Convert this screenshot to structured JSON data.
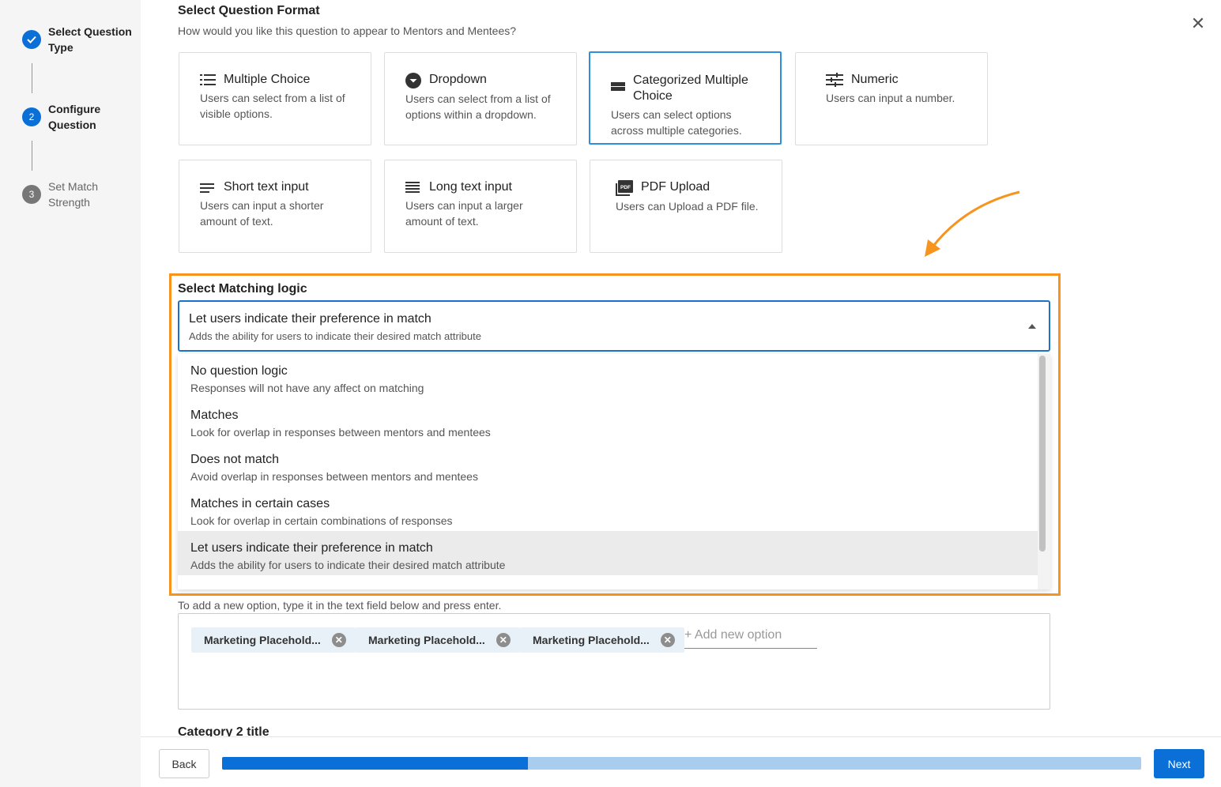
{
  "stepper": {
    "steps": [
      {
        "number": "1",
        "label": "Select Question Type",
        "status": "done"
      },
      {
        "number": "2",
        "label": "Configure Question",
        "status": "active"
      },
      {
        "number": "3",
        "label": "Set Match Strength",
        "status": "pending"
      }
    ]
  },
  "header": {
    "title": "Select Question Format",
    "subtitle": "How would you like this question to appear to Mentors and Mentees?"
  },
  "formats": [
    {
      "title": "Multiple Choice",
      "desc": "Users can select from a list of visible options.",
      "icon": "list-icon"
    },
    {
      "title": "Dropdown",
      "desc": "Users can select from a list of options within a dropdown.",
      "icon": "dropdown-icon"
    },
    {
      "title": "Categorized Multiple Choice",
      "desc": "Users can select options across multiple categories.",
      "icon": "category-icon",
      "selected": true
    },
    {
      "title": "Numeric",
      "desc": "Users can input a number.",
      "icon": "sliders-icon"
    },
    {
      "title": "Short text input",
      "desc": "Users can input a shorter amount of text.",
      "icon": "short-text-icon"
    },
    {
      "title": "Long text input",
      "desc": "Users can input a larger amount of text.",
      "icon": "long-text-icon"
    },
    {
      "title": "PDF Upload",
      "desc": "Users can Upload a PDF file.",
      "icon": "pdf-icon"
    }
  ],
  "matching": {
    "label": "Select Matching logic",
    "selected_title": "Let users indicate their preference in match",
    "selected_sub": "Adds the ability for users to indicate their desired match attribute",
    "options": [
      {
        "title": "No question logic",
        "sub": "Responses will not have any affect on matching"
      },
      {
        "title": "Matches",
        "sub": "Look for overlap in responses between mentors and mentees"
      },
      {
        "title": "Does not match",
        "sub": "Avoid overlap in responses between mentors and mentees"
      },
      {
        "title": "Matches in certain cases",
        "sub": "Look for overlap in certain combinations of responses"
      },
      {
        "title": "Let users indicate their preference in match",
        "sub": "Adds the ability for users to indicate their desired match attribute"
      }
    ]
  },
  "options_section": {
    "hint": "To add a new option, type it in the text field below and press enter.",
    "chips": [
      "Marketing Placehold...",
      "Marketing Placehold...",
      "Marketing Placehold..."
    ],
    "add_placeholder": "+ Add new option"
  },
  "category2_title": "Category 2 title",
  "footer": {
    "back_label": "Back",
    "next_label": "Next",
    "progress": 0.333
  },
  "colors": {
    "accent": "#0a6fd6",
    "highlight": "#f7941d",
    "selected_border": "#2f8fdd"
  }
}
